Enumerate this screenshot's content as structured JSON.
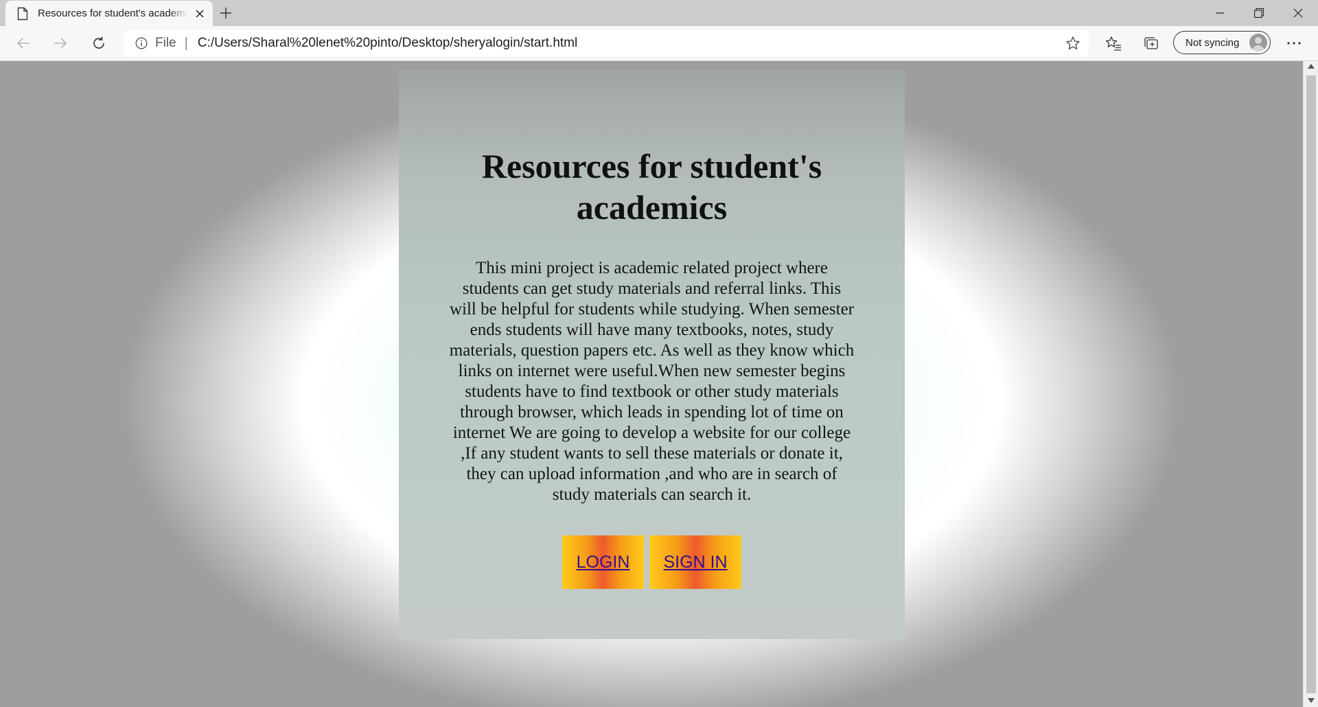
{
  "browser": {
    "tab": {
      "title": "Resources for student's academics"
    },
    "address": {
      "scheme": "File",
      "separator": "|",
      "url": "C:/Users/Sharal%20lenet%20pinto/Desktop/sheryalogin/start.html"
    },
    "sync": {
      "label": "Not syncing"
    },
    "icons": [
      "document-icon",
      "close-icon",
      "plus-icon",
      "minimize-icon",
      "restore-icon",
      "close-window-icon",
      "back-icon",
      "forward-icon",
      "refresh-icon",
      "info-icon",
      "star-icon",
      "favorites-icon",
      "collections-icon",
      "profile-icon",
      "more-icon"
    ]
  },
  "page": {
    "heading": "Resources for student's academics",
    "description": "This mini project is academic related project where students can get study materials and referral links. This will be helpful for students while studying. When semester ends students will have many textbooks, notes, study materials, question papers etc. As well as they know which links on internet were useful.When new semester begins students have to find textbook or other study materials through browser, which leads in spending lot of time on internet We are going to develop a website for our college ,If any student wants to sell these materials or donate it, they can upload information ,and who are in search of study materials can search it.",
    "buttons": {
      "login": "LOGIN",
      "signin": "SIGN IN"
    }
  },
  "colors": {
    "button_gradient": [
      "#ffcb1a",
      "#ee5a2c"
    ],
    "link_text": "#3a0e8c",
    "panel": "#bdcbc8"
  }
}
